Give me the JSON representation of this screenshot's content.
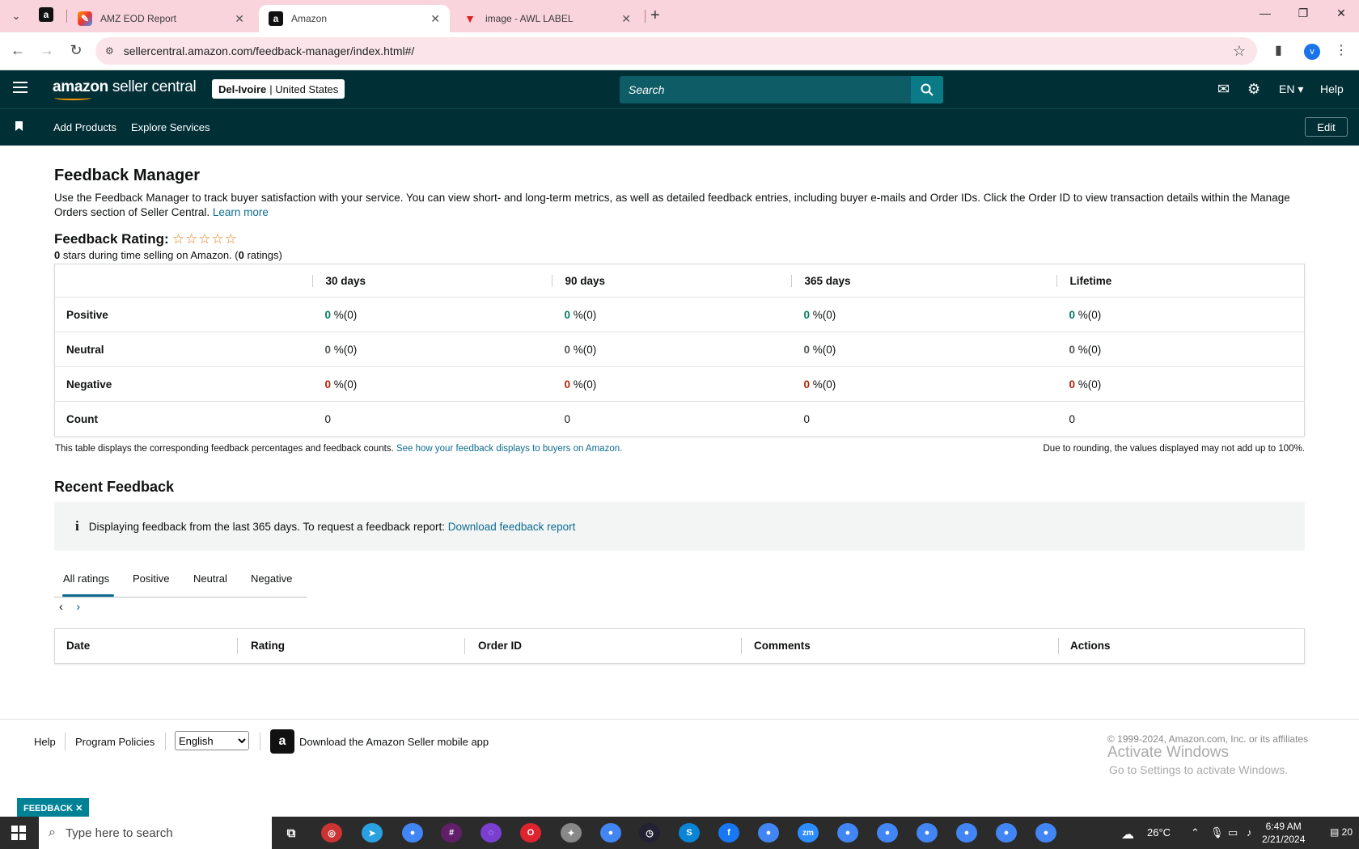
{
  "browser": {
    "tabs": [
      {
        "title": "",
        "favicon": "amazon-icon"
      },
      {
        "title": "AMZ EOD Report",
        "favicon": "report-icon"
      },
      {
        "title": "Amazon",
        "favicon": "amazon-icon"
      },
      {
        "title": "image - AWL LABEL",
        "favicon": "awl-icon"
      }
    ],
    "url": "sellercentral.amazon.com/feedback-manager/index.html#/",
    "profile_initial": "v"
  },
  "header": {
    "logo_bold": "amazon",
    "logo_rest": " seller central",
    "store": "Del-Ivoire",
    "marketplace": "| United States",
    "search_placeholder": "Search",
    "language": "EN",
    "help": "Help"
  },
  "subnav": {
    "items": [
      "Add Products",
      "Explore Services"
    ],
    "edit": "Edit"
  },
  "page": {
    "title": "Feedback Manager",
    "intro": "Use the Feedback Manager to track buyer satisfaction with your service. You can view short- and long-term metrics, as well as detailed feedback entries, including buyer e-mails and Order IDs. Click the Order ID to view transaction details within the Manage Orders section of Seller Central.",
    "learn_more": "Learn more",
    "rating_title": "Feedback Rating:",
    "stars": "☆☆☆☆☆",
    "rating_stars_value": "0",
    "rating_text_mid": " stars during time selling on Amazon. (",
    "rating_count": "0",
    "rating_text_end": " ratings)"
  },
  "feedback_table": {
    "headers": [
      "30 days",
      "90 days",
      "365 days",
      "Lifetime"
    ],
    "rows": [
      {
        "label": "Positive",
        "kind": "pos",
        "values": [
          "0",
          "0",
          "0",
          "0"
        ],
        "suffix": "%(0)"
      },
      {
        "label": "Neutral",
        "kind": "neu",
        "values": [
          "0",
          "0",
          "0",
          "0"
        ],
        "suffix": "%(0)"
      },
      {
        "label": "Negative",
        "kind": "neg",
        "values": [
          "0",
          "0",
          "0",
          "0"
        ],
        "suffix": "%(0)"
      },
      {
        "label": "Count",
        "kind": "count",
        "values": [
          "0",
          "0",
          "0",
          "0"
        ],
        "suffix": ""
      }
    ],
    "note_left": "This table displays the corresponding feedback percentages and feedback counts.",
    "note_link": "See how your feedback displays to buyers on Amazon.",
    "note_right": "Due to rounding, the values displayed may not add up to 100%."
  },
  "recent": {
    "title": "Recent Feedback",
    "info_text": "Displaying feedback from the last 365 days. To request a feedback report:",
    "info_link": "Download feedback report",
    "tabs": [
      "All ratings",
      "Positive",
      "Neutral",
      "Negative"
    ],
    "columns": [
      "Date",
      "Rating",
      "Order ID",
      "Comments",
      "Actions"
    ]
  },
  "footer": {
    "help": "Help",
    "policies": "Program Policies",
    "language": "English",
    "app_text": "Download the Amazon Seller mobile app",
    "copyright": "© 1999-2024, Amazon.com, Inc. or its affiliates",
    "watermark_title": "Activate Windows",
    "watermark_sub": "Go to Settings to activate Windows.",
    "feedback_tag": "FEEDBACK ✕"
  },
  "taskbar": {
    "search_placeholder": "Type here to search",
    "weather": "26°C",
    "time": "6:49 AM",
    "date": "2/21/2024",
    "notifications": "20"
  },
  "colors": {
    "header_bg": "#002f36",
    "positive": "#067d62",
    "negative": "#b12704",
    "link": "#0e6b8f"
  }
}
